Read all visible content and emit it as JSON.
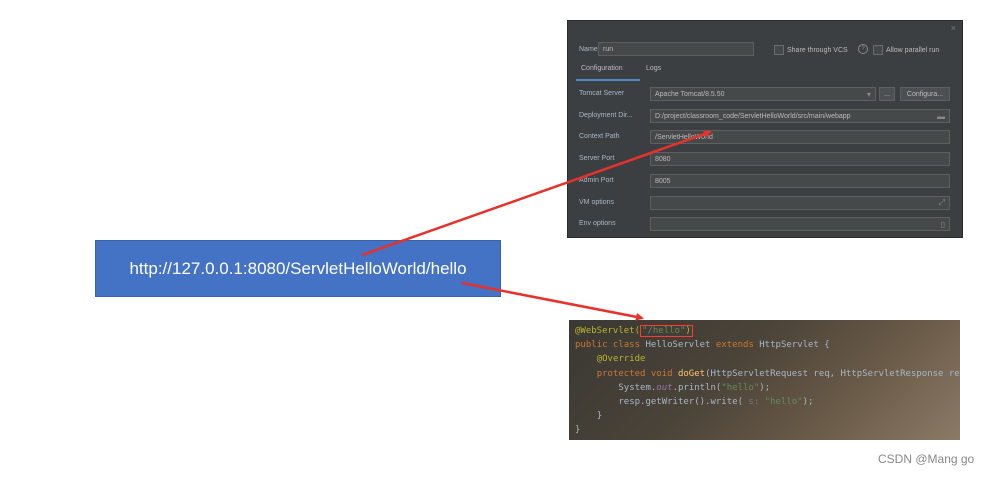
{
  "url_box": {
    "text": "http://127.0.0.1:8080/ServletHelloWorld/hello"
  },
  "config": {
    "close": "×",
    "name_label": "Name:",
    "name_value": "run",
    "share_vcs": "Share through VCS",
    "help": "?",
    "allow_parallel": "Allow parallel run",
    "tabs": [
      "Configuration",
      "Logs"
    ],
    "rows": [
      {
        "label": "Tomcat Server",
        "value": "Apache Tomcat/8.5.50"
      },
      {
        "label": "Deployment Dir...",
        "value": "D:/project/classroom_code/ServletHelloWorld/src/main/webapp"
      },
      {
        "label": "Context Path",
        "value": "/ServletHelloWorld"
      },
      {
        "label": "Server Port",
        "value": "8080"
      },
      {
        "label": "Admin Port",
        "value": "8005"
      },
      {
        "label": "VM options",
        "value": ""
      },
      {
        "label": "Env options",
        "value": ""
      }
    ],
    "more_button": "...",
    "configure_button": "Configura..."
  },
  "code": {
    "l1_ann": "@WebServlet(",
    "l1_str": "\"/hello\"",
    "l1_close": ")",
    "l2_kw": "public class ",
    "l2_name": "HelloServlet ",
    "l2_kw2": "extends ",
    "l2_rest": "HttpServlet {",
    "l3_ann": "@Override",
    "l4_kw": "protected void ",
    "l4_fn": "doGet",
    "l4_rest": "(HttpServletRequest req, HttpServletResponse resp)",
    "l5_a": "System.",
    "l5_field": "out",
    "l5_b": ".println(",
    "l5_str": "\"hello\"",
    "l5_c": ");",
    "l6_a": "resp.getWriter().write( ",
    "l6_hint": "s: ",
    "l6_str": "\"hello\"",
    "l6_c": ");",
    "l7": "}",
    "l8": "}"
  },
  "watermark": "CSDN @Mang go",
  "colors": {
    "url_box": "#4472c4",
    "arrow": "#e8312a",
    "panel_bg": "#3c3f41"
  }
}
